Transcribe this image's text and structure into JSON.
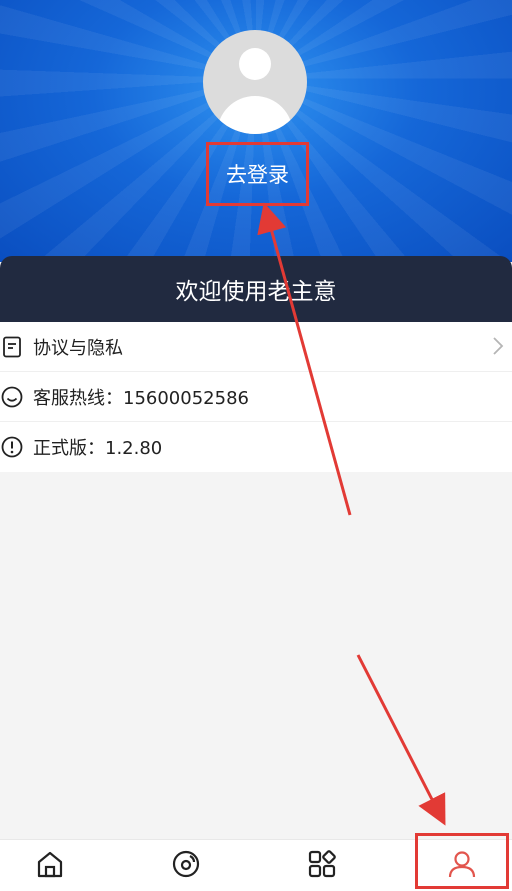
{
  "header": {
    "login_label": "去登录"
  },
  "welcome": {
    "text": "欢迎使用老主意"
  },
  "menu": {
    "items": [
      {
        "label": "协议与隐私",
        "icon": "document-icon",
        "has_arrow": true
      },
      {
        "label": "客服热线：15600052586",
        "icon": "smile-icon",
        "has_arrow": false
      },
      {
        "label": "正式版：1.2.80",
        "icon": "info-icon",
        "has_arrow": false
      }
    ]
  },
  "tabbar": {
    "tabs": [
      {
        "icon": "home-icon"
      },
      {
        "icon": "discover-icon"
      },
      {
        "icon": "apps-icon"
      },
      {
        "icon": "profile-icon",
        "active": true
      }
    ]
  },
  "colors": {
    "header_blue": "#1567d8",
    "banner": "#212a40",
    "annotation_red": "#e23a35",
    "active_tab": "#e2554d"
  }
}
